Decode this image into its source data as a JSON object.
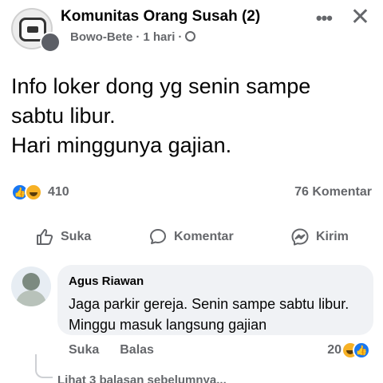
{
  "header": {
    "group_name": "Komunitas Orang Susah (2)",
    "author": "Bowo-Bete",
    "time": "1 hari",
    "more_label": "•••",
    "close_label": "✕",
    "privacy_icon": "globe-icon"
  },
  "post": {
    "line1": "Info loker dong yg senin sampe",
    "line2": "sabtu libur.",
    "line3": "Hari minggunya gajian."
  },
  "stats": {
    "reaction_count": "410",
    "comment_count": "76 Komentar",
    "reaction_icons": [
      "like-icon",
      "haha-icon"
    ]
  },
  "actions": {
    "like": "Suka",
    "comment": "Komentar",
    "share": "Kirim"
  },
  "comment": {
    "author": "Agus Riawan",
    "text": "Jaga parkir gereja. Senin sampe sabtu libur. Minggu masuk langsung gajian",
    "like_label": "Suka",
    "reply_label": "Balas",
    "reaction_count": "20"
  },
  "replies": {
    "label": "Lihat 3 balasan sebelumnya..."
  },
  "colors": {
    "accent": "#1877f2",
    "secondary_text": "#65676b",
    "bubble": "#f0f2f5"
  }
}
